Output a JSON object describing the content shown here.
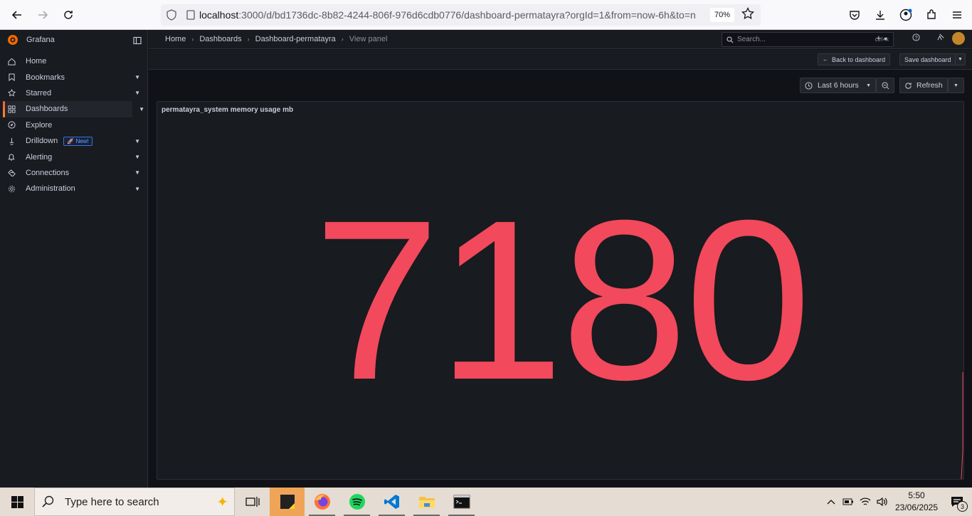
{
  "browser": {
    "url_host": "localhost",
    "url_rest": ":3000/d/bd1736dc-8b82-4244-806f-976d6cdb0776/dashboard-permatayra?orgId=1&from=now-6h&to=n",
    "zoom": "70%"
  },
  "sidebar": {
    "brand": "Grafana",
    "items": [
      {
        "label": "Home",
        "icon": "home-icon",
        "chevron": false
      },
      {
        "label": "Bookmarks",
        "icon": "bookmark-icon",
        "chevron": true
      },
      {
        "label": "Starred",
        "icon": "star-icon",
        "chevron": true
      },
      {
        "label": "Dashboards",
        "icon": "apps-icon",
        "chevron": true,
        "active": true
      },
      {
        "label": "Explore",
        "icon": "compass-icon",
        "chevron": false
      },
      {
        "label": "Drilldown",
        "icon": "drilldown-icon",
        "chevron": true,
        "badge": "New!"
      },
      {
        "label": "Alerting",
        "icon": "bell-icon",
        "chevron": true
      },
      {
        "label": "Connections",
        "icon": "plug-icon",
        "chevron": true
      },
      {
        "label": "Administration",
        "icon": "cog-icon",
        "chevron": true
      }
    ]
  },
  "breadcrumb": {
    "home": "Home",
    "dashboards": "Dashboards",
    "dashboard": "Dashboard-permatayra",
    "current": "View panel"
  },
  "search": {
    "placeholder": "Search...",
    "shortcut": "ctrl+k"
  },
  "toolbar": {
    "back_label": "Back to dashboard",
    "save_label": "Save dashboard",
    "time_range": "Last 6 hours",
    "refresh_label": "Refresh"
  },
  "panel": {
    "title": "permatayra_system memory usage mb",
    "value": "7180",
    "value_color": "#f2495c"
  },
  "taskbar": {
    "search_placeholder": "Type here to search",
    "time": "5:50",
    "date": "23/06/2025",
    "notification_count": "3"
  }
}
